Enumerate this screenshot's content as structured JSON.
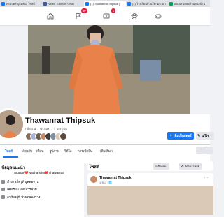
{
  "browser": {
    "tabs": [
      {
        "label": "ครอบครัว(สีมคัน) โพสต์",
        "color": "#1877f2"
      },
      {
        "label": "Video Tutorials Onlin",
        "color": "#3b5998"
      },
      {
        "label": "(1) Thawanrat Thipsuk |",
        "color": "#1877f2",
        "active": true
      },
      {
        "label": "(1) โรงเรียนบ้านโคกมะกอก",
        "color": "#1877f2"
      },
      {
        "label": "แบบเสนอขอตำแหน่งบ้าน",
        "color": "#0f9d58"
      }
    ]
  },
  "topnav": {
    "badges": {
      "notifications": "9+",
      "watch": "1"
    }
  },
  "profile": {
    "name": "Thawanrat Thipsuk",
    "friends_line": "เพื่อน 4.1 พัน คน · 1 คนรู้จัก",
    "add_story": "เพิ่มเป็นสตอรี่",
    "edit": "แก้ไข",
    "tabs": [
      "โพสต์",
      "เกี่ยวกับ",
      "เพื่อน",
      "รูปภาพ",
      "วิดีโอ",
      "การเช็คอิน",
      "เพิ่มเติม"
    ]
  },
  "intro": {
    "title": "ข้อมูลแนะนำ",
    "bio": "Attakan❤️Nattharicha❤️Thawanrat",
    "lines": [
      "ทำงานที่ครูที่ ยูคดอจาน",
      "เคยเรียน มหาสารคาม",
      "อาศัยอยู่ที่ บ้านดอนสรวง"
    ]
  },
  "posts": {
    "title": "โพสต์",
    "filter_btn": "ตัวกรอง",
    "manage_btn": "จัดการโพสต์",
    "author": "Thawanrat Thipsuk",
    "meta": "1 ชม. · 🌐"
  },
  "colors": {
    "brand": "#1877f2",
    "badge": "#e41e3f"
  }
}
